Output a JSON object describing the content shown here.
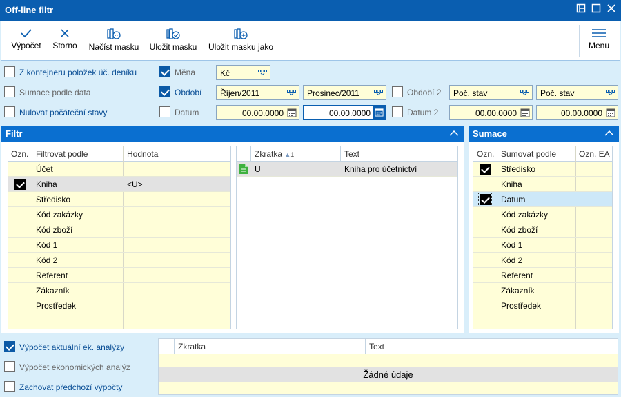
{
  "window": {
    "title": "Off-line filtr"
  },
  "toolbar": {
    "calc": "Výpočet",
    "cancel": "Storno",
    "load_mask": "Načíst masku",
    "save_mask": "Uložit masku",
    "save_mask_as": "Uložit masku jako",
    "menu": "Menu"
  },
  "options": {
    "from_container": "Z kontejneru položek úč. deníku",
    "sum_by_date": "Sumace podle data",
    "reset_initial": "Nulovat počáteční stavy",
    "currency_label": "Měna",
    "currency_value": "Kč",
    "period_label": "Období",
    "period_from": "Říjen/2011",
    "period_to": "Prosinec/2011",
    "period2_label": "Období 2",
    "period2_from": "Poč. stav",
    "period2_to": "Poč. stav",
    "date_label": "Datum",
    "date_from": "00.00.0000",
    "date_to": "00.00.0000",
    "date2_label": "Datum 2",
    "date2_from": "00.00.0000",
    "date2_to": "00.00.0000"
  },
  "filter": {
    "title": "Filtr",
    "headers": {
      "mark": "Ozn.",
      "filter_by": "Filtrovat podle",
      "value": "Hodnota"
    },
    "rows": [
      {
        "name": "Účet",
        "value": ""
      },
      {
        "name": "Kniha",
        "value": "<U>"
      },
      {
        "name": "Středisko",
        "value": ""
      },
      {
        "name": "Kód zakázky",
        "value": ""
      },
      {
        "name": "Kód zboží",
        "value": ""
      },
      {
        "name": "Kód 1",
        "value": ""
      },
      {
        "name": "Kód 2",
        "value": ""
      },
      {
        "name": "Referent",
        "value": ""
      },
      {
        "name": "Zákazník",
        "value": ""
      },
      {
        "name": "Prostředek",
        "value": ""
      }
    ],
    "detail_headers": {
      "abbr": "Zkratka",
      "sort": "1",
      "text": "Text"
    },
    "detail_rows": [
      {
        "abbr": "U",
        "text": "Kniha pro účetnictví"
      }
    ]
  },
  "sumace": {
    "title": "Sumace",
    "headers": {
      "mark": "Ozn.",
      "sum_by": "Sumovat podle",
      "ea": "Ozn. EA"
    },
    "rows": [
      {
        "name": "Středisko"
      },
      {
        "name": "Kniha"
      },
      {
        "name": "Datum"
      },
      {
        "name": "Kód zakázky"
      },
      {
        "name": "Kód zboží"
      },
      {
        "name": "Kód 1"
      },
      {
        "name": "Kód 2"
      },
      {
        "name": "Referent"
      },
      {
        "name": "Zákazník"
      },
      {
        "name": "Prostředek"
      }
    ]
  },
  "bottom": {
    "calc_current": "Výpočet aktuální ek. analýzy",
    "calc_economic": "Výpočet ekonomických analýz",
    "keep_previous": "Zachovat předchozí výpočty",
    "headers": {
      "abbr": "Zkratka",
      "text": "Text"
    },
    "empty": "Žádné údaje"
  },
  "colors": {
    "titlebar": "#0a5eb0",
    "panel_header": "#0a6fd0",
    "background": "#d9eefa",
    "grid_row": "#fffed8",
    "accent": "#0c5aa6"
  }
}
